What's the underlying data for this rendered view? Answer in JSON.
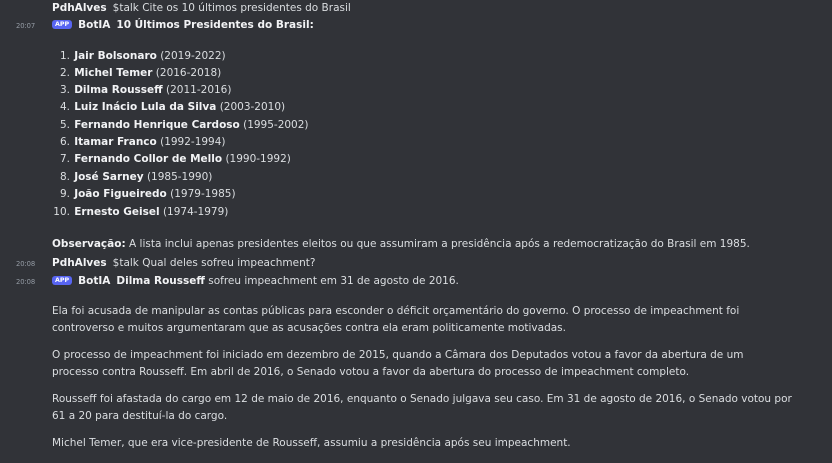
{
  "messages": {
    "m1": {
      "author": "PdhAlves",
      "text": "$talk Cite os 10 últimos presidentes do Brasil"
    },
    "m2": {
      "time": "20:07",
      "tag": "APP",
      "author": "BotIA",
      "title": "10 Últimos Presidentes do Brasil:",
      "list": [
        {
          "num": "1.",
          "name": "Jair Bolsonaro",
          "years": "(2019-2022)"
        },
        {
          "num": "2.",
          "name": "Michel Temer",
          "years": "(2016-2018)"
        },
        {
          "num": "3.",
          "name": "Dilma Rousseff",
          "years": "(2011-2016)"
        },
        {
          "num": "4.",
          "name": "Luiz Inácio Lula da Silva",
          "years": "(2003-2010)"
        },
        {
          "num": "5.",
          "name": "Fernando Henrique Cardoso",
          "years": "(1995-2002)"
        },
        {
          "num": "6.",
          "name": "Itamar Franco",
          "years": "(1992-1994)"
        },
        {
          "num": "7.",
          "name": "Fernando Collor de Mello",
          "years": "(1990-1992)"
        },
        {
          "num": "8.",
          "name": "José Sarney",
          "years": "(1985-1990)"
        },
        {
          "num": "9.",
          "name": "João Figueiredo",
          "years": "(1979-1985)"
        },
        {
          "num": "10.",
          "name": "Ernesto Geisel",
          "years": "(1974-1979)"
        }
      ],
      "note_label": "Observação:",
      "note_text": "A lista inclui apenas presidentes eleitos ou que assumiram a presidência após a redemocratização do Brasil em 1985."
    },
    "m3": {
      "time": "20:08",
      "author": "PdhAlves",
      "text": "$talk Qual deles sofreu impeachment?"
    },
    "m4": {
      "time": "20:08",
      "tag": "APP",
      "author": "BotIA",
      "lead_bold": "Dilma Rousseff",
      "lead_text": "sofreu impeachment em 31 de agosto de 2016.",
      "p1": "Ela foi acusada de manipular as contas públicas para esconder o déficit orçamentário do governo. O processo de impeachment foi controverso e muitos argumentaram que as acusações contra ela eram politicamente motivadas.",
      "p2": "O processo de impeachment foi iniciado em dezembro de 2015, quando a Câmara dos Deputados votou a favor da abertura de um processo contra Rousseff. Em abril de 2016, o Senado votou a favor da abertura do processo de impeachment completo.",
      "p3": "Rousseff foi afastada do cargo em 12 de maio de 2016, enquanto o Senado julgava seu caso. Em 31 de agosto de 2016, o Senado votou por 61 a 20 para destituí-la do cargo.",
      "p4": "Michel Temer, que era vice-presidente de Rousseff, assumiu a presidência após seu impeachment."
    }
  }
}
